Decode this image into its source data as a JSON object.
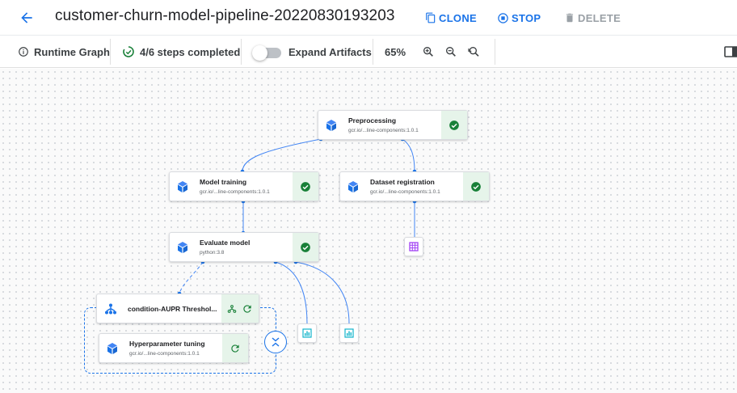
{
  "header": {
    "title": "customer-churn-model-pipeline-20220830193203",
    "actions": {
      "clone": "CLONE",
      "stop": "STOP",
      "delete": "DELETE"
    }
  },
  "toolbar": {
    "runtime_graph": "Runtime Graph",
    "steps_completed": "4/6 steps completed",
    "expand_artifacts": "Expand Artifacts",
    "expand_artifacts_on": false,
    "zoom_level": "65%"
  },
  "nodes": {
    "preprocessing": {
      "title": "Preprocessing",
      "subtitle": "gcr.io/...line-components:1.0.1",
      "status": "succeeded"
    },
    "model_training": {
      "title": "Model training",
      "subtitle": "gcr.io/...line-components:1.0.1",
      "status": "succeeded"
    },
    "dataset_registration": {
      "title": "Dataset registration",
      "subtitle": "gcr.io/...line-components:1.0.1",
      "status": "succeeded"
    },
    "evaluate_model": {
      "title": "Evaluate model",
      "subtitle": "python:3.8",
      "status": "succeeded"
    },
    "condition": {
      "title": "condition-AUPR Threshol...",
      "status": "running"
    },
    "hyperparameter_tuning": {
      "title": "Hyperparameter tuning",
      "subtitle": "gcr.io/...line-components:1.0.1",
      "status": "running"
    }
  },
  "colors": {
    "accent": "#1a73e8",
    "success": "#188038",
    "success_bg": "#e6f4ea",
    "artifact_purple": "#a142f4",
    "artifact_teal": "#12b5cb",
    "edge": "#4285f4"
  },
  "icons": {
    "back": "arrow-back-icon",
    "clone": "copy-icon",
    "stop": "stop-circle-icon",
    "delete": "trash-icon",
    "info": "info-icon",
    "progress": "progress-check-icon",
    "zoom_in": "zoom-in-icon",
    "zoom_out": "zoom-out-icon",
    "zoom_reset": "zoom-reset-icon",
    "panel": "side-panel-icon",
    "component": "cube-icon",
    "success": "check-circle-icon",
    "running": "refresh-icon",
    "condition": "branch-icon",
    "dataset_artifact": "grid-table-icon",
    "metrics_artifact": "bar-chart-icon",
    "expand": "expand-collapse-icon"
  }
}
